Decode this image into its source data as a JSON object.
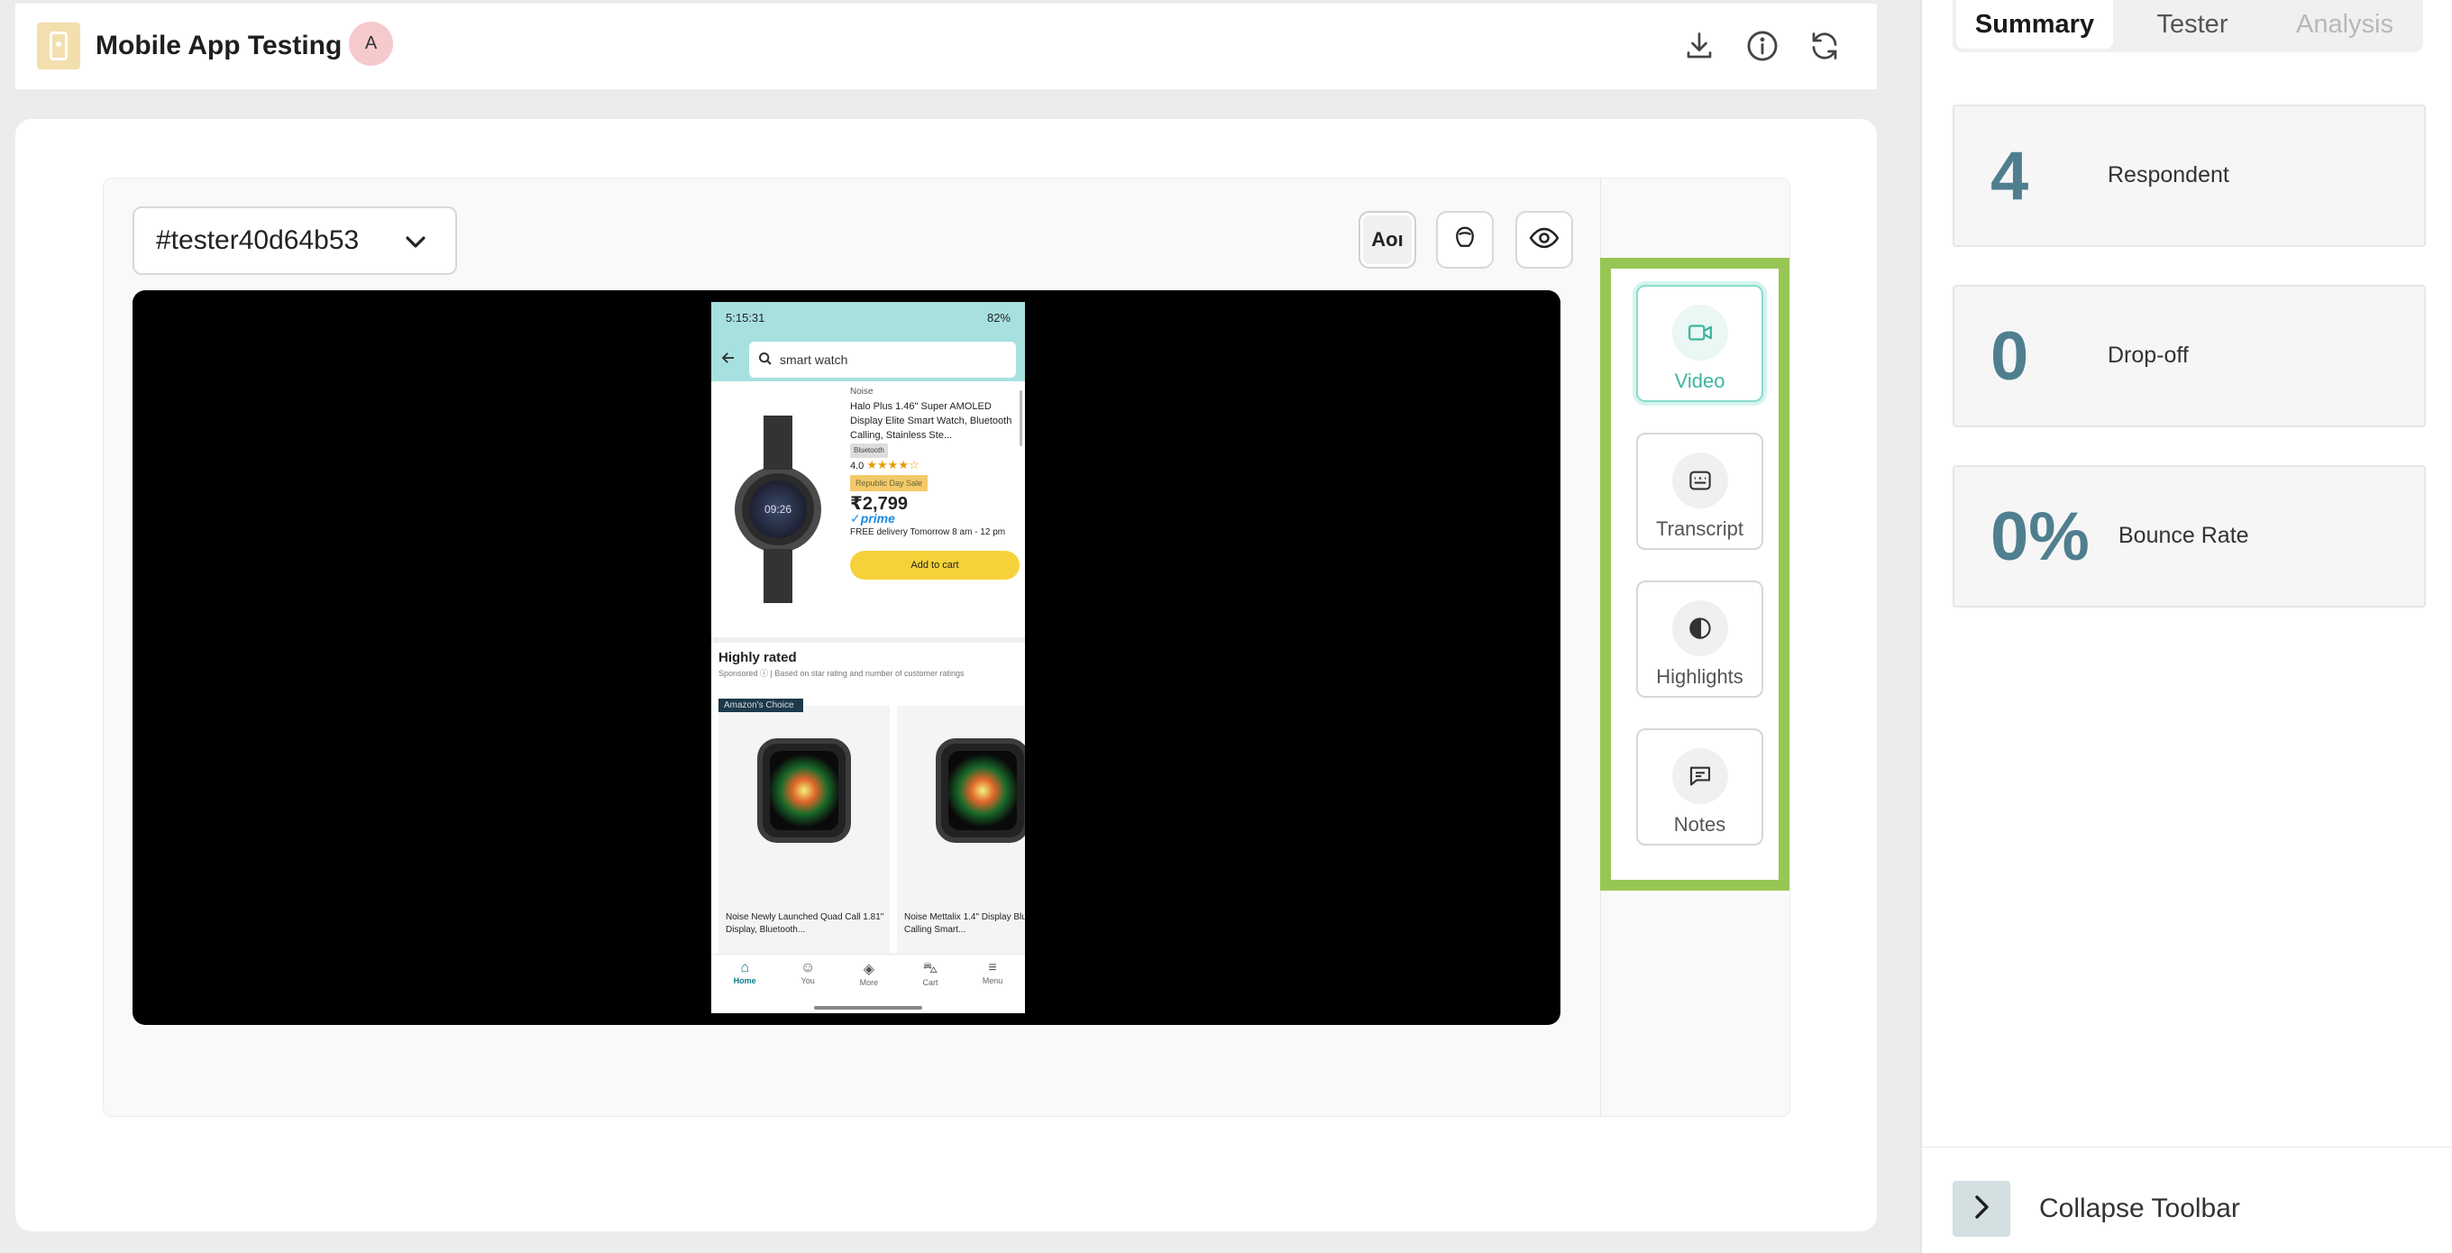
{
  "header": {
    "title": "Mobile App Testing",
    "avatar_initial": "A",
    "icons": [
      "download-icon",
      "info-icon",
      "refresh-icon"
    ]
  },
  "player": {
    "tester_select": {
      "value": "#tester40d64b53"
    },
    "toolbar": {
      "aoi_label": "AOI",
      "icons": [
        "aoi-icon",
        "head-icon",
        "eye-icon"
      ]
    },
    "phone": {
      "status_time": "5:15:31",
      "status_right": "82%",
      "search_text": "smart watch",
      "product": {
        "brand": "Noise",
        "name": "Halo Plus 1.46\" Super AMOLED Display Elite Smart Watch, Bluetooth Calling, Stainless Ste...",
        "chip": "Bluetooth",
        "rating": "4.0",
        "stars": "★★★★☆",
        "deal": "Republic Day Sale",
        "price": "₹2,799",
        "prime": "✓prime",
        "delivery": "FREE delivery Tomorrow 8 am - 12 pm",
        "cart_label": "Add to cart"
      },
      "highly_rated": {
        "title": "Highly rated",
        "subtitle": "Sponsored  ⓘ  | Based on star rating and number of customer ratings",
        "badge": "Amazon's Choice",
        "items": [
          {
            "caption": "Noise Newly Launched Quad Call 1.81\" Display, Bluetooth..."
          },
          {
            "caption": "Noise Mettalix 1.4\" Display Bluetooth Calling Smart..."
          }
        ]
      },
      "nav": [
        "Home",
        "You",
        "More",
        "Cart",
        "Menu"
      ]
    }
  },
  "side_tabs": [
    {
      "label": "Video",
      "icon": "video-camera-icon",
      "active": true
    },
    {
      "label": "Transcript",
      "icon": "transcript-icon",
      "active": false
    },
    {
      "label": "Highlights",
      "icon": "highlights-icon",
      "active": false
    },
    {
      "label": "Notes",
      "icon": "notes-icon",
      "active": false
    }
  ],
  "right_panel": {
    "tabs": [
      {
        "label": "Summary",
        "state": "active"
      },
      {
        "label": "Tester",
        "state": "normal"
      },
      {
        "label": "Analysis",
        "state": "disabled"
      }
    ],
    "stats": [
      {
        "value": "4",
        "label": "Respondent"
      },
      {
        "value": "0",
        "label": "Drop-off"
      },
      {
        "value": "0%",
        "label": "Bounce Rate"
      }
    ],
    "collapse_label": "Collapse Toolbar"
  },
  "colors": {
    "accent_green_border": "#97c655",
    "active_tab_teal": "#3fb59e",
    "stat_number": "#4f7f8f",
    "app_icon_bg": "#f3dfae",
    "avatar_bg": "#f6c9cd"
  }
}
